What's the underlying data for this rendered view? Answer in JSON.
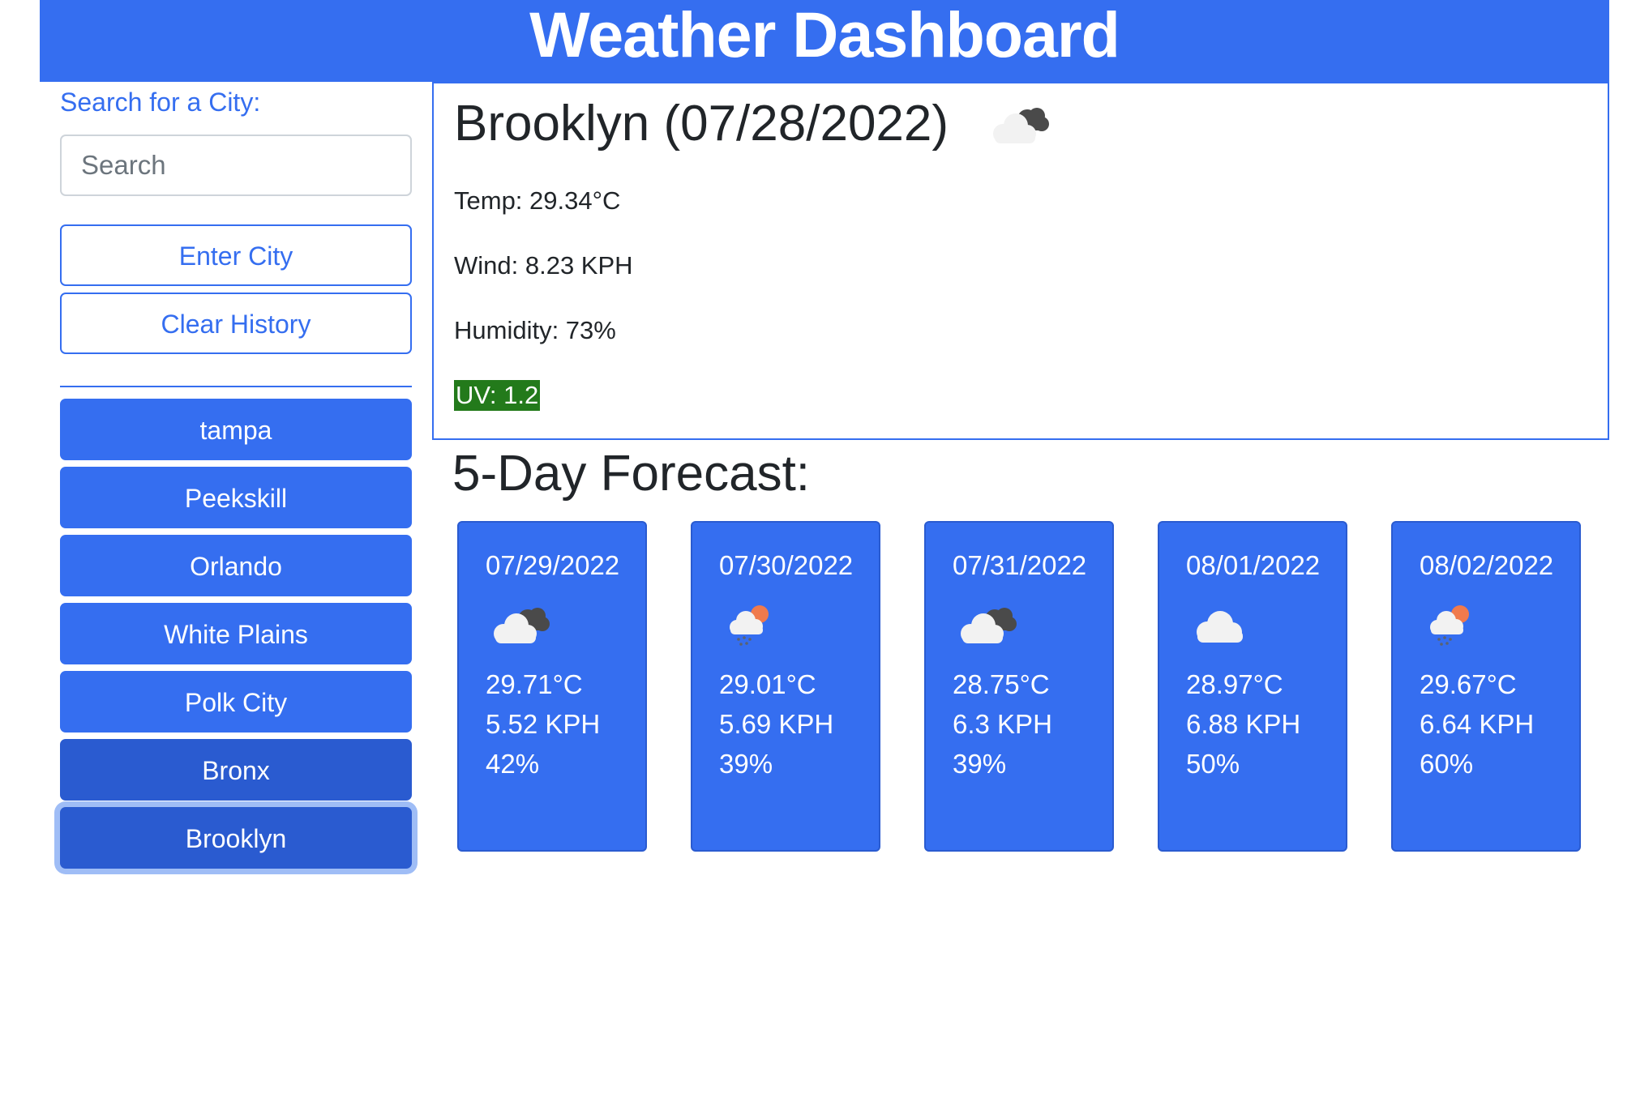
{
  "header": {
    "title": "Weather Dashboard"
  },
  "sidebar": {
    "search_label": "Search for a City:",
    "search_placeholder": "Search",
    "search_value": "",
    "enter_button": "Enter City",
    "clear_button": "Clear History",
    "history": [
      {
        "label": "tampa",
        "state": "normal"
      },
      {
        "label": "Peekskill",
        "state": "normal"
      },
      {
        "label": "Orlando",
        "state": "normal"
      },
      {
        "label": "White Plains",
        "state": "normal"
      },
      {
        "label": "Polk City",
        "state": "normal"
      },
      {
        "label": "Bronx",
        "state": "hover"
      },
      {
        "label": "Brooklyn",
        "state": "focused"
      }
    ]
  },
  "current": {
    "title": "Brooklyn (07/28/2022)",
    "icon": "broken-clouds-icon",
    "temp": "Temp: 29.34°C",
    "wind": "Wind: 8.23 KPH",
    "humidity": "Humidity: 73%",
    "uv": "UV: 1.2",
    "uv_color": "#237a1b"
  },
  "forecast": {
    "heading": "5-Day Forecast:",
    "days": [
      {
        "date": "07/29/2022",
        "icon": "broken-clouds-icon",
        "temp": "29.71°C",
        "wind": "5.52 KPH",
        "humidity": "42%"
      },
      {
        "date": "07/30/2022",
        "icon": "rain-sun-icon",
        "temp": "29.01°C",
        "wind": "5.69 KPH",
        "humidity": "39%"
      },
      {
        "date": "07/31/2022",
        "icon": "broken-clouds-icon",
        "temp": "28.75°C",
        "wind": "6.3 KPH",
        "humidity": "39%"
      },
      {
        "date": "08/01/2022",
        "icon": "cloud-icon",
        "temp": "28.97°C",
        "wind": "6.88 KPH",
        "humidity": "50%"
      },
      {
        "date": "08/02/2022",
        "icon": "rain-sun-icon",
        "temp": "29.67°C",
        "wind": "6.64 KPH",
        "humidity": "60%"
      }
    ]
  },
  "colors": {
    "primary": "#356ef0",
    "primary_dark": "#2a5bd0",
    "focus_ring": "#9fbdf6",
    "uv_low": "#237a1b"
  }
}
